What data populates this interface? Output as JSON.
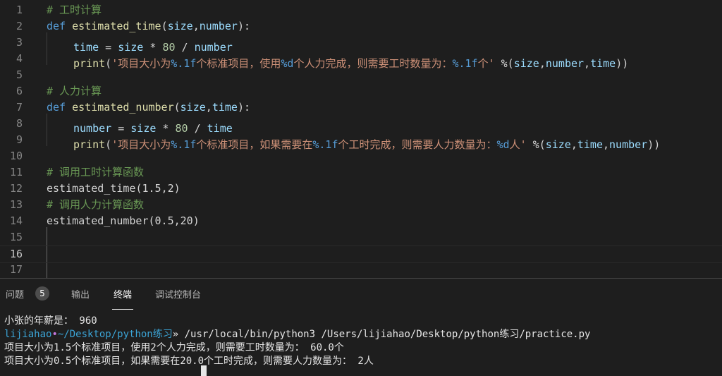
{
  "editor": {
    "line_numbers": [
      "1",
      "2",
      "3",
      "4",
      "5",
      "6",
      "7",
      "8",
      "9",
      "10",
      "11",
      "12",
      "13",
      "14",
      "15",
      "16",
      "17"
    ],
    "lines": [
      {
        "tokens": [
          {
            "t": "# 工时计算",
            "c": "comment"
          }
        ]
      },
      {
        "tokens": [
          {
            "t": "def",
            "c": "kw"
          },
          {
            "t": " ",
            "c": "op"
          },
          {
            "t": "estimated_time",
            "c": "fn"
          },
          {
            "t": "(",
            "c": "punc"
          },
          {
            "t": "size",
            "c": "var"
          },
          {
            "t": ",",
            "c": "punc"
          },
          {
            "t": "number",
            "c": "var"
          },
          {
            "t": "):",
            "c": "punc"
          }
        ]
      },
      {
        "indent": 1,
        "tokens": [
          {
            "t": "time",
            "c": "var"
          },
          {
            "t": " = ",
            "c": "op"
          },
          {
            "t": "size",
            "c": "var"
          },
          {
            "t": " * ",
            "c": "op"
          },
          {
            "t": "80",
            "c": "num"
          },
          {
            "t": " / ",
            "c": "op"
          },
          {
            "t": "number",
            "c": "var"
          }
        ]
      },
      {
        "indent": 1,
        "tokens": [
          {
            "t": "print",
            "c": "fn"
          },
          {
            "t": "(",
            "c": "punc"
          },
          {
            "t": "'项目大小为",
            "c": "str"
          },
          {
            "t": "%.1f",
            "c": "fmt"
          },
          {
            "t": "个标准项目，使用",
            "c": "str"
          },
          {
            "t": "%d",
            "c": "fmt"
          },
          {
            "t": "个人力完成，则需要工时数量为：",
            "c": "str"
          },
          {
            "t": "%.1f",
            "c": "fmt"
          },
          {
            "t": "个'",
            "c": "str"
          },
          {
            "t": " %(",
            "c": "op"
          },
          {
            "t": "size",
            "c": "var"
          },
          {
            "t": ",",
            "c": "punc"
          },
          {
            "t": "number",
            "c": "var"
          },
          {
            "t": ",",
            "c": "punc"
          },
          {
            "t": "time",
            "c": "var"
          },
          {
            "t": "))",
            "c": "punc"
          }
        ]
      },
      {
        "tokens": []
      },
      {
        "tokens": [
          {
            "t": "# 人力计算",
            "c": "comment"
          }
        ]
      },
      {
        "tokens": [
          {
            "t": "def",
            "c": "kw"
          },
          {
            "t": " ",
            "c": "op"
          },
          {
            "t": "estimated_number",
            "c": "fn"
          },
          {
            "t": "(",
            "c": "punc"
          },
          {
            "t": "size",
            "c": "var"
          },
          {
            "t": ",",
            "c": "punc"
          },
          {
            "t": "time",
            "c": "var"
          },
          {
            "t": "):",
            "c": "punc"
          }
        ]
      },
      {
        "indent": 1,
        "tokens": [
          {
            "t": "number",
            "c": "var"
          },
          {
            "t": " = ",
            "c": "op"
          },
          {
            "t": "size",
            "c": "var"
          },
          {
            "t": " * ",
            "c": "op"
          },
          {
            "t": "80",
            "c": "num"
          },
          {
            "t": " / ",
            "c": "op"
          },
          {
            "t": "time",
            "c": "var"
          }
        ]
      },
      {
        "indent": 1,
        "tokens": [
          {
            "t": "print",
            "c": "fn"
          },
          {
            "t": "(",
            "c": "punc"
          },
          {
            "t": "'项目大小为",
            "c": "str"
          },
          {
            "t": "%.1f",
            "c": "fmt"
          },
          {
            "t": "个标准项目，如果需要在",
            "c": "str"
          },
          {
            "t": "%.1f",
            "c": "fmt"
          },
          {
            "t": "个工时完成，则需要人力数量为：",
            "c": "str"
          },
          {
            "t": "%d",
            "c": "fmt"
          },
          {
            "t": "人'",
            "c": "str"
          },
          {
            "t": " %(",
            "c": "op"
          },
          {
            "t": "size",
            "c": "var"
          },
          {
            "t": ",",
            "c": "punc"
          },
          {
            "t": "time",
            "c": "var"
          },
          {
            "t": ",",
            "c": "punc"
          },
          {
            "t": "number",
            "c": "var"
          },
          {
            "t": "))",
            "c": "punc"
          }
        ]
      },
      {
        "tokens": []
      },
      {
        "tokens": [
          {
            "t": "# 调用工时计算函数",
            "c": "comment"
          }
        ]
      },
      {
        "tokens": [
          {
            "t": "estimated_time",
            "c": "op"
          },
          {
            "t": "(",
            "c": "punc"
          },
          {
            "t": "1.5",
            "c": "op"
          },
          {
            "t": ",",
            "c": "punc"
          },
          {
            "t": "2",
            "c": "op"
          },
          {
            "t": ")",
            "c": "punc"
          }
        ]
      },
      {
        "tokens": [
          {
            "t": "# 调用人力计算函数",
            "c": "comment"
          }
        ]
      },
      {
        "tokens": [
          {
            "t": "estimated_number",
            "c": "op"
          },
          {
            "t": "(",
            "c": "punc"
          },
          {
            "t": "0.5",
            "c": "op"
          },
          {
            "t": ",",
            "c": "punc"
          },
          {
            "t": "20",
            "c": "op"
          },
          {
            "t": ")",
            "c": "punc"
          }
        ]
      },
      {
        "tokens": []
      },
      {
        "tokens": []
      },
      {
        "tokens": []
      }
    ],
    "current_line": 16
  },
  "panel": {
    "tabs": [
      {
        "label": "问题",
        "name": "tab-problems"
      },
      {
        "label": "输出",
        "name": "tab-output"
      },
      {
        "label": "终端",
        "name": "tab-terminal",
        "active": true
      },
      {
        "label": "调试控制台",
        "name": "tab-debug-console"
      }
    ],
    "problems_count": "5"
  },
  "terminal": {
    "line1": "小张的年薪是： 960",
    "prompt_user": "lijiahao",
    "prompt_dot": "•",
    "prompt_path": "~/Desktop/python练习",
    "prompt_arrow": "»",
    "command": " /usr/local/bin/python3 /Users/lijiahao/Desktop/python练习/practice.py",
    "output1": "项目大小为1.5个标准项目，使用2个人力完成，则需要工时数量为： 60.0个",
    "output2": "项目大小为0.5个标准项目，如果需要在20.0个工时完成，则需要人力数量为： 2人"
  }
}
